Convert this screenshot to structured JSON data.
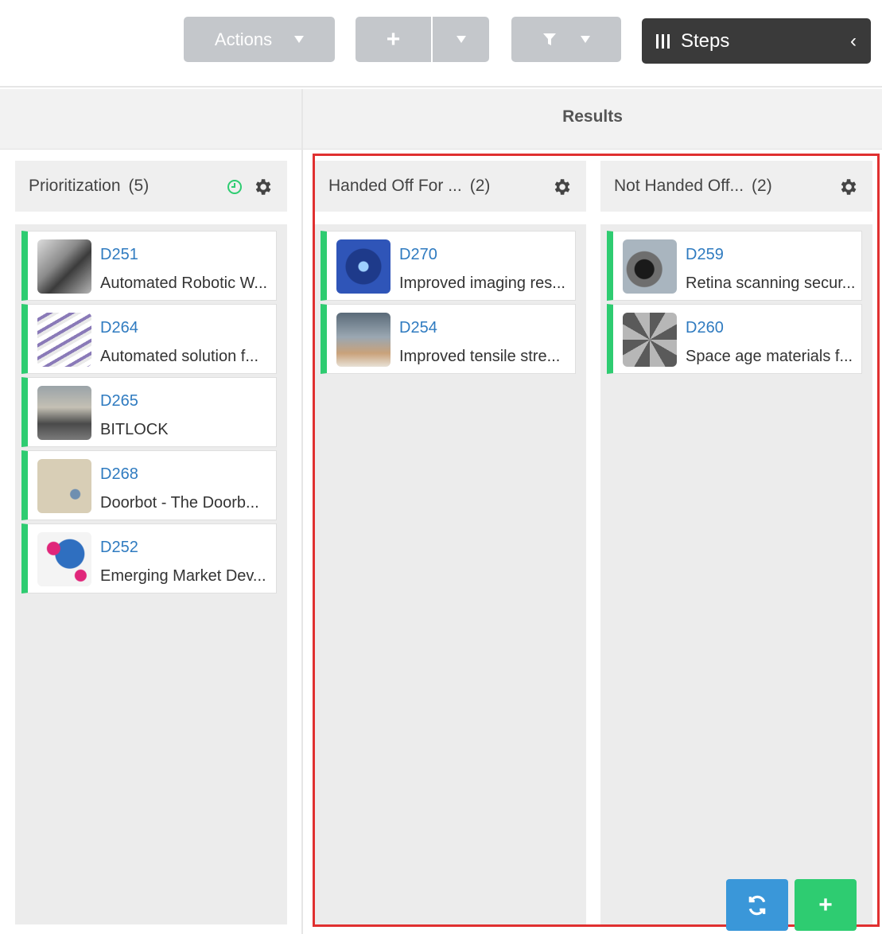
{
  "toolbar": {
    "actions_label": "Actions",
    "add_label": "+",
    "steps_label": "Steps",
    "steps_chevron": "‹"
  },
  "group": {
    "results_label": "Results"
  },
  "lanes": [
    {
      "title": "Prioritization",
      "count": "(5)",
      "cards": [
        {
          "id": "D251",
          "name": "Automated Robotic W...",
          "thumb": "lab-equipment"
        },
        {
          "id": "D264",
          "name": "Automated solution f...",
          "thumb": "dna-helix"
        },
        {
          "id": "D265",
          "name": "BITLOCK",
          "thumb": "street-bikes"
        },
        {
          "id": "D268",
          "name": "Doorbot - The Doorb...",
          "thumb": "doorbot-device"
        },
        {
          "id": "D252",
          "name": "Emerging Market Dev...",
          "thumb": "world-map"
        }
      ]
    },
    {
      "title": "Handed Off For ...",
      "count": "(2)",
      "cards": [
        {
          "id": "D270",
          "name": "Improved imaging res...",
          "thumb": "camera-lens"
        },
        {
          "id": "D254",
          "name": "Improved tensile stre...",
          "thumb": "metal-tubes"
        }
      ]
    },
    {
      "title": "Not Handed Off...",
      "count": "(2)",
      "cards": [
        {
          "id": "D259",
          "name": "Retina scanning secur...",
          "thumb": "retina-scan"
        },
        {
          "id": "D260",
          "name": "Space age materials f...",
          "thumb": "geometric-panel"
        }
      ]
    }
  ],
  "colors": {
    "accent": "#2ecc71",
    "link": "#2f7bc0",
    "highlight": "#e03030",
    "refresh": "#3a97d9"
  }
}
